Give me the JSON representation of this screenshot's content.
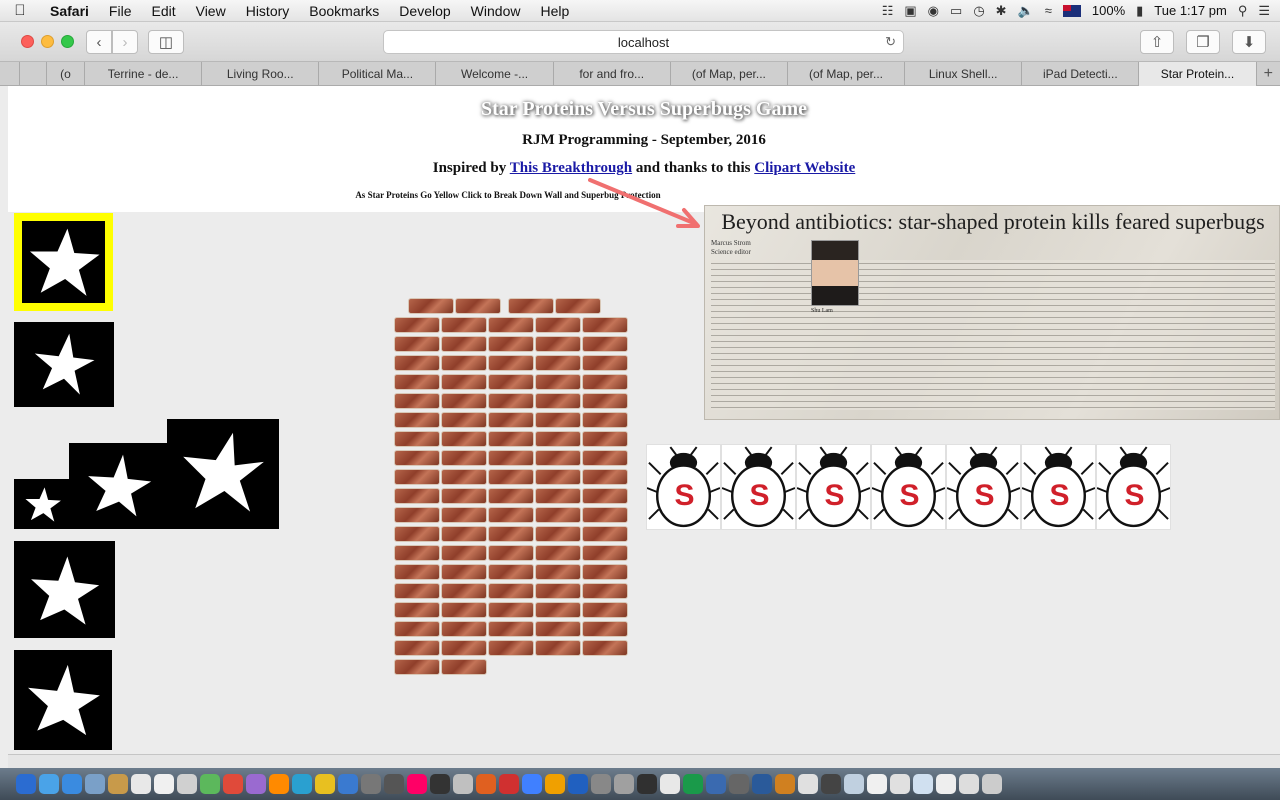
{
  "menubar": {
    "app": "Safari",
    "items": [
      "File",
      "Edit",
      "View",
      "History",
      "Bookmarks",
      "Develop",
      "Window",
      "Help"
    ],
    "battery": "100%",
    "clock": "Tue 1:17 pm"
  },
  "toolbar": {
    "address": "localhost"
  },
  "tabs": [
    {
      "label": "(o"
    },
    {
      "label": "Terrine - de..."
    },
    {
      "label": "Living Roo..."
    },
    {
      "label": "Political Ma..."
    },
    {
      "label": "Welcome -..."
    },
    {
      "label": "for and fro..."
    },
    {
      "label": "(of Map, per..."
    },
    {
      "label": "(of Map, per..."
    },
    {
      "label": "Linux Shell..."
    },
    {
      "label": "iPad Detecti..."
    },
    {
      "label": "Star Protein..."
    }
  ],
  "page": {
    "title": "Star Proteins Versus Superbugs Game",
    "credit": "RJM Programming - September, 2016",
    "inspired_prefix": "Inspired by ",
    "breakthrough_link": "This Breakthrough",
    "inspired_middle": " and thanks to this ",
    "clipart_link": "Clipart Website",
    "instruction": "As Star Proteins Go Yellow Click to Break Down Wall and Superbug Protection"
  },
  "news": {
    "headline": "Beyond antibiotics: star-shaped protein kills feared superbugs",
    "byline_name": "Marcus Strom",
    "byline_role": "Science editor",
    "photo_caption": "Shu Lam"
  },
  "superbug_letter": "S",
  "colors": {
    "selected_outline": "#ffff00",
    "link": "#1a1aa6",
    "superbug_letter": "#d0202a",
    "arrow": "#f07070"
  }
}
